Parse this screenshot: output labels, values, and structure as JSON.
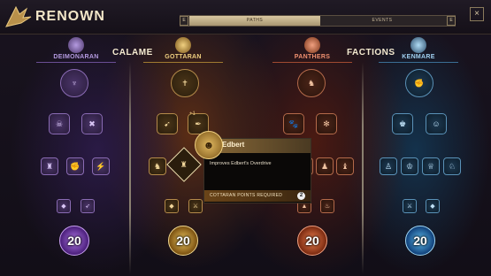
{
  "header": {
    "title": "RENOWN",
    "close_glyph": "×",
    "tabs": [
      {
        "label": "PATHS",
        "active": true
      },
      {
        "label": "EVENTS",
        "active": false
      }
    ],
    "tab_prev_key": "E",
    "tab_next_key": "E"
  },
  "groups": {
    "left": "CALAME",
    "right": "FACTIONS"
  },
  "columns": [
    {
      "name": "DEIMONARAN",
      "color": "#9a7ccf",
      "crest_icon": "wolf-crest-icon"
    },
    {
      "name": "GOTTARAN",
      "color": "#e0b060",
      "crest_icon": "sun-crest-icon"
    },
    {
      "name": "PANTHERS",
      "color": "#e07a4a",
      "crest_icon": "panther-crest-icon"
    },
    {
      "name": "KENMARE",
      "color": "#7ab8e0",
      "crest_icon": "windmill-crest-icon"
    }
  ],
  "badges": [
    "20",
    "20",
    "20",
    "20"
  ],
  "tooltip": {
    "name": "Edbert",
    "description": "Improves Edbert's Overdrive",
    "requirement_label": "COTTARAN POINTS REQUIRED",
    "requirement_value": "2"
  },
  "node_level_label": "+1",
  "colors": {
    "deimonaran": "#8a6bb4",
    "gottaran": "#b48a4a",
    "panthers": "#b46a4a",
    "kenmare": "#5a92b8"
  }
}
